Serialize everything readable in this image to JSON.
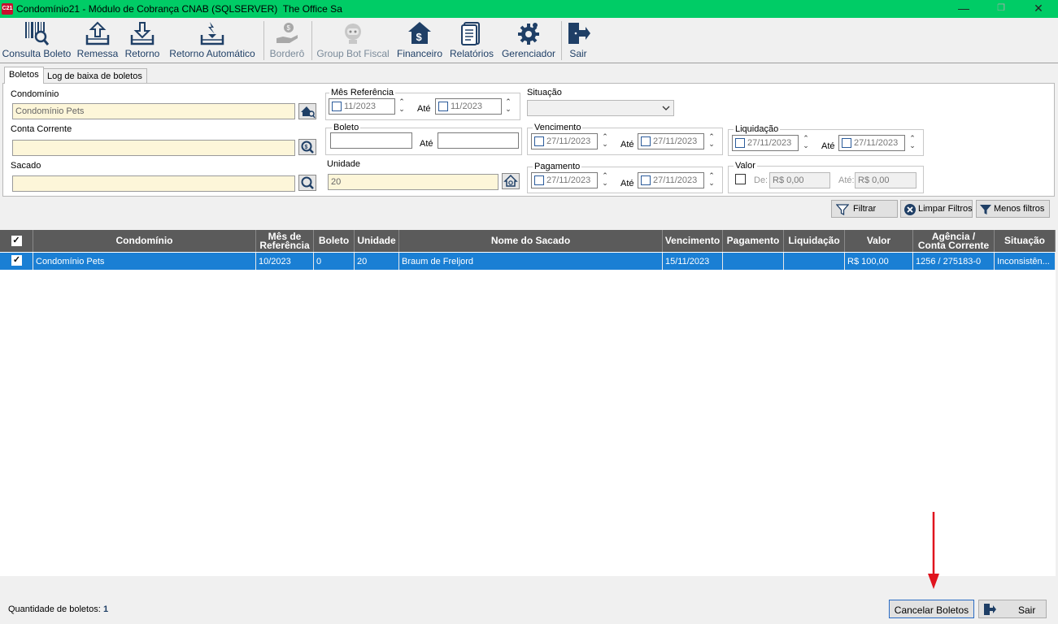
{
  "window": {
    "logo": "C21",
    "title": "Condomínio21 - Módulo de Cobrança CNAB (SQLSERVER)  The Office Sa",
    "minimize": "—",
    "maximize": "❐",
    "close": "✕"
  },
  "toolbar": {
    "items": [
      {
        "label": "Consulta Boleto",
        "icon": "barcode-search-icon",
        "enabled": true
      },
      {
        "label": "Remessa",
        "icon": "upload-tray-icon",
        "enabled": true
      },
      {
        "label": "Retorno",
        "icon": "download-tray-icon",
        "enabled": true
      },
      {
        "label": "Retorno Automático",
        "icon": "auto-return-tray-icon",
        "enabled": true
      },
      {
        "label": "Borderô",
        "icon": "money-hand-icon",
        "enabled": false
      },
      {
        "label": "Group Bot Fiscal",
        "icon": "robot-icon",
        "enabled": false
      },
      {
        "label": "Financeiro",
        "icon": "house-dollar-icon",
        "enabled": true
      },
      {
        "label": "Relatórios",
        "icon": "report-icon",
        "enabled": true
      },
      {
        "label": "Gerenciador",
        "icon": "gear-icon",
        "enabled": true
      },
      {
        "label": "Sair",
        "icon": "exit-door-icon",
        "enabled": true
      }
    ]
  },
  "tabs": [
    {
      "label": "Boletos",
      "active": true
    },
    {
      "label": "Log de baixa de boletos",
      "active": false
    }
  ],
  "filters": {
    "condominio_label": "Condomínio",
    "condominio_value": "Condomínio Pets",
    "conta_label": "Conta Corrente",
    "conta_value": "",
    "sacado_label": "Sacado",
    "sacado_value": "",
    "mes_ref_label": "Mês Referência",
    "mes_ref_from": "11/2023",
    "mes_ref_to": "11/2023",
    "ate": "Até",
    "boleto_label": "Boleto",
    "boleto_from": "",
    "boleto_to": "",
    "unidade_label": "Unidade",
    "unidade_value": "20",
    "situacao_label": "Situação",
    "situacao_value": "",
    "vencimento_label": "Vencimento",
    "vencimento_from": "27/11/2023",
    "vencimento_to": "27/11/2023",
    "pagamento_label": "Pagamento",
    "pagamento_from": "27/11/2023",
    "pagamento_to": "27/11/2023",
    "liquidacao_label": "Liquidação",
    "liquidacao_from": "27/11/2023",
    "liquidacao_to": "27/11/2023",
    "valor_label": "Valor",
    "valor_de_label": "De:",
    "valor_de": "R$ 0,00",
    "valor_ate_label": "Até:",
    "valor_ate": "R$ 0,00"
  },
  "filter_buttons": {
    "filtrar": "Filtrar",
    "limpar": "Limpar Filtros",
    "menos": "Menos filtros"
  },
  "grid": {
    "headers": {
      "condominio": "Condomínio",
      "mes_ref_1": "Mês de",
      "mes_ref_2": "Referência",
      "boleto": "Boleto",
      "unidade": "Unidade",
      "sacado": "Nome do Sacado",
      "vencimento": "Vencimento",
      "pagamento": "Pagamento",
      "liquidacao": "Liquidação",
      "valor": "Valor",
      "agencia_1": "Agência /",
      "agencia_2": "Conta Corrente",
      "situacao": "Situação"
    },
    "rows": [
      {
        "checked": true,
        "condominio": "Condomínio Pets",
        "mes_ref": "10/2023",
        "boleto": "0",
        "unidade": "20",
        "sacado": "Braum de Freljord",
        "vencimento": "15/11/2023",
        "pagamento": "",
        "liquidacao": "",
        "valor": "R$ 100,00",
        "agencia": "1256 / 275183-0",
        "situacao": "Inconsistên..."
      }
    ]
  },
  "footer": {
    "count_label": "Quantidade de boletos:",
    "count_value": "1",
    "cancelar": "Cancelar Boletos",
    "sair": "Sair"
  },
  "colors": {
    "titlebar": "#00cc66",
    "selection": "#1a7fd4",
    "header": "#5b5b5b",
    "annotation_arrow": "#e0141e"
  }
}
